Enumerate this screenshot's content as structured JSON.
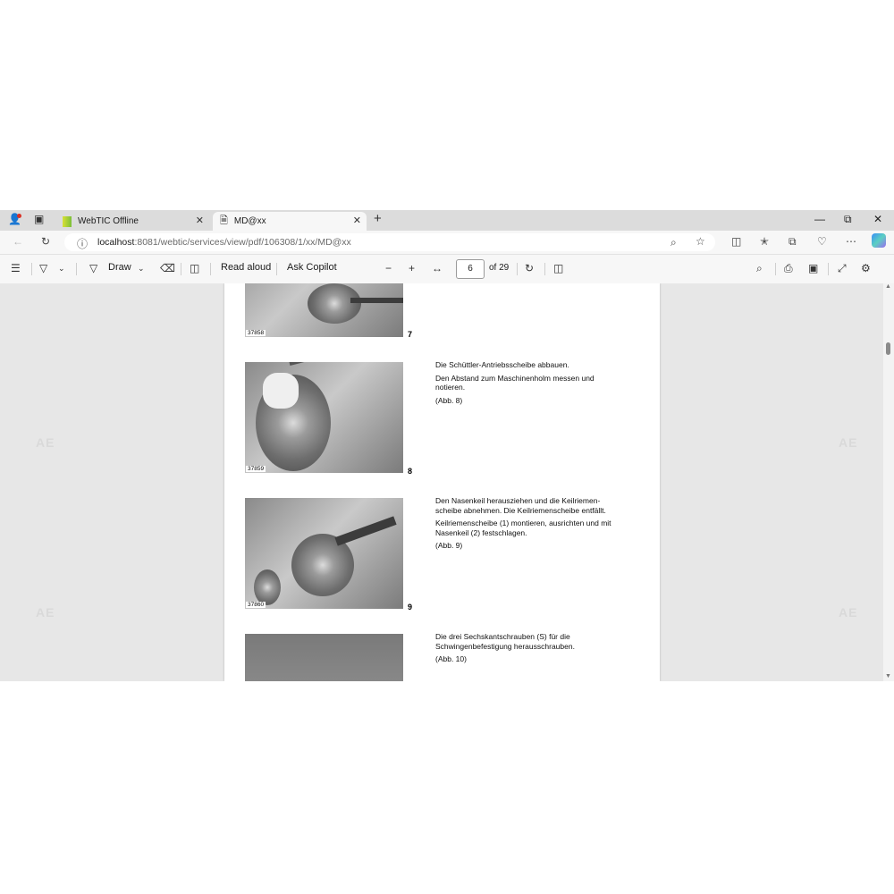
{
  "tabs": [
    {
      "title": "WebTIC Offline",
      "icon": "webtic-favicon"
    },
    {
      "title": "MD@xx",
      "icon": "document-icon",
      "active": true
    }
  ],
  "address": {
    "host": "localhost",
    "path": ":8081/webtic/services/view/pdf/106308/1/xx/MD@xx"
  },
  "pdf_toolbar": {
    "draw_label": "Draw",
    "read_aloud_label": "Read aloud",
    "ask_copilot_label": "Ask Copilot",
    "page_value": "6",
    "page_total": "of 29"
  },
  "document": {
    "watermark": "AE",
    "figures": [
      {
        "code": "37858",
        "number": "7",
        "paragraphs": []
      },
      {
        "code": "37859",
        "number": "8",
        "paragraphs": [
          "Die Schüttler-Antriebsscheibe abbauen.",
          "Den Abstand zum Maschinenholm messen und notieren.",
          "(Abb. 8)"
        ]
      },
      {
        "code": "37860",
        "number": "9",
        "paragraphs": [
          "Den Nasenkeil herausziehen und die Keilriemen-scheibe abnehmen. Die Keilriemenscheibe entfällt.",
          "Keilriemenscheibe (1) montieren, ausrichten und mit Nasenkeil (2) festschlagen.",
          "(Abb. 9)"
        ]
      },
      {
        "code": "",
        "number": "",
        "paragraphs": [
          "Die drei Sechskantschrauben (S) für die Schwingenbefestigung herausschrauben.",
          "(Abb. 10)"
        ]
      }
    ]
  }
}
